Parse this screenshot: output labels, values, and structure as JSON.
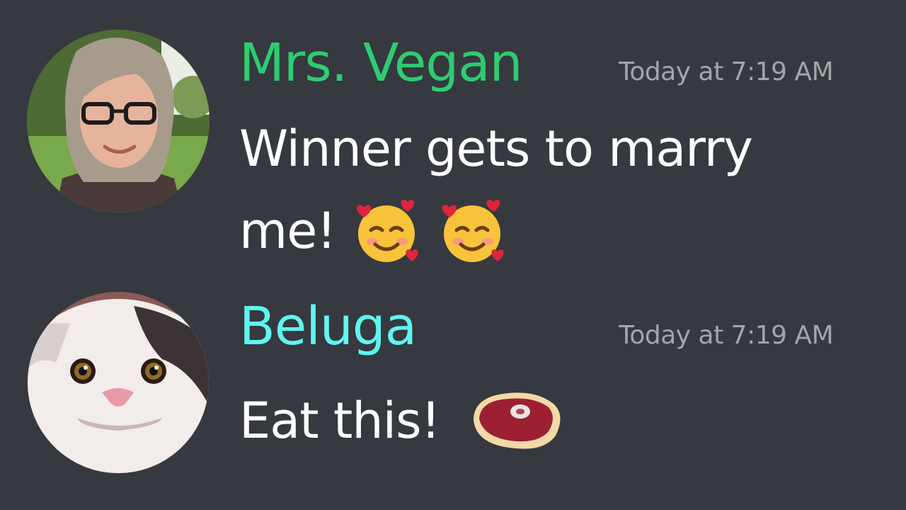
{
  "theme": {
    "background": "#36393f",
    "text": "#ffffff",
    "timestamp": "#a3a6aa"
  },
  "messages": [
    {
      "username": "Mrs. Vegan",
      "username_color": "#2ecc71",
      "timestamp": "Today at 7:19 AM",
      "text": "Winner gets to marry me!",
      "emojis": [
        "smiling-face-with-hearts",
        "smiling-face-with-hearts"
      ],
      "avatar": "woman-with-glasses-avatar"
    },
    {
      "username": "Beluga",
      "username_color": "#5ff5f0",
      "timestamp": "Today at 7:19 AM",
      "text": "Eat this!",
      "emojis": [
        "cut-of-meat"
      ],
      "avatar": "beluga-cat-avatar"
    }
  ]
}
